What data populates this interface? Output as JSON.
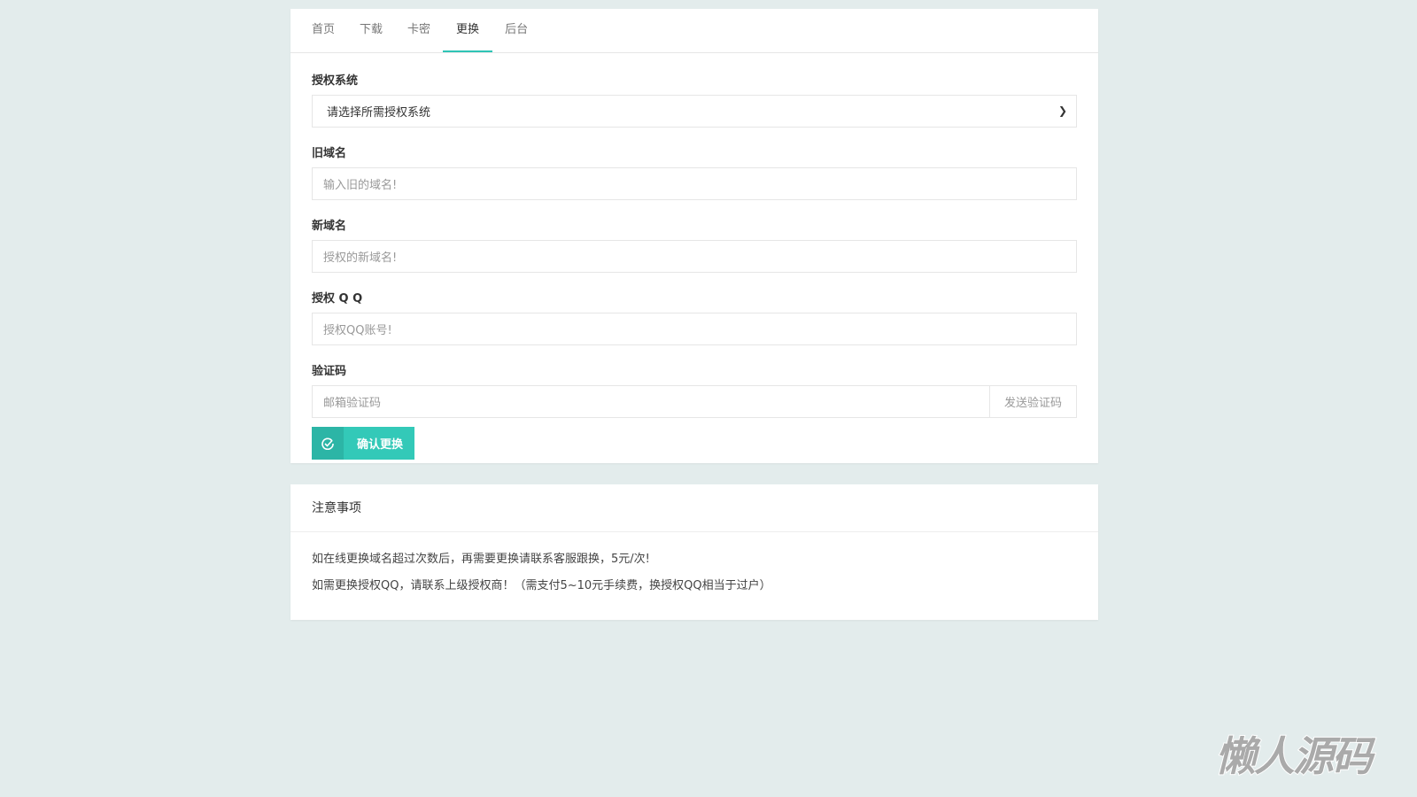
{
  "tabs": [
    "首页",
    "下载",
    "卡密",
    "更换",
    "后台"
  ],
  "form": {
    "system_label": "授权系统",
    "system_value": "请选择所需授权系统",
    "old_label": "旧域名",
    "old_placeholder": "输入旧的域名!",
    "new_label": "新域名",
    "new_placeholder": "授权的新域名!",
    "qq_label": "授权 Q Q",
    "qq_placeholder": "授权QQ账号!",
    "code_label": "验证码",
    "code_placeholder": "邮箱验证码",
    "send_label": "发送验证码",
    "submit_label": "确认更换"
  },
  "notice": {
    "title": "注意事项",
    "lines": [
      "如在线更换域名超过次数后，再需要更换请联系客服跟换，5元/次!",
      "如需更换授权QQ，请联系上级授权商！（需支付5~10元手续费，换授权QQ相当于过户）"
    ]
  },
  "watermark": "懒人源码",
  "colors": {
    "accent": "#33c9b8"
  }
}
